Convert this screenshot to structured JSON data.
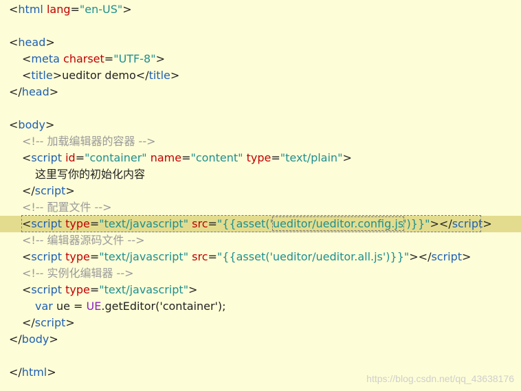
{
  "code": {
    "l1": {
      "lt": "<",
      "tag": "html",
      "attr": "lang",
      "eq": "=",
      "val": "\"en-US\"",
      "gt": ">"
    },
    "l3": {
      "lt": "<",
      "tag": "head",
      "gt": ">"
    },
    "l4": {
      "lt": "<",
      "tag": "meta",
      "attr": "charset",
      "eq": "=",
      "val": "\"UTF-8\"",
      "gt": ">"
    },
    "l5": {
      "lt": "<",
      "tag": "title",
      "gt": ">",
      "text": "ueditor demo",
      "lt2": "</",
      "tag2": "title",
      "gt2": ">"
    },
    "l6": {
      "lt": "</",
      "tag": "head",
      "gt": ">"
    },
    "l8": {
      "lt": "<",
      "tag": "body",
      "gt": ">"
    },
    "l9": {
      "comment": "<!-- 加载编辑器的容器 -->"
    },
    "l10": {
      "lt": "<",
      "tag": "script",
      "a1": "id",
      "eq1": "=",
      "v1": "\"container\"",
      "a2": "name",
      "eq2": "=",
      "v2": "\"content\"",
      "a3": "type",
      "eq3": "=",
      "v3": "\"text/plain\"",
      "gt": ">"
    },
    "l11": {
      "text": "这里写你的初始化内容"
    },
    "l12": {
      "lt": "</",
      "tag": "script",
      "gt": ">"
    },
    "l13": {
      "comment": "<!-- 配置文件 -->"
    },
    "l14": {
      "lt": "<",
      "tag": "script",
      "a1": "type",
      "eq1": "=",
      "v1": "\"text/javascript\"",
      "a2": "src",
      "eq2": "=",
      "v2a": "\"{{asset('",
      "v2b": "ueditor/ueditor.config.js",
      "v2c": "')}}\"",
      "gt": ">",
      "lt2": "</",
      "tag2": "script",
      "gt2": ">"
    },
    "l15": {
      "comment": "<!-- 编辑器源码文件 -->"
    },
    "l16": {
      "lt": "<",
      "tag": "script",
      "a1": "type",
      "eq1": "=",
      "v1": "\"text/javascript\"",
      "a2": "src",
      "eq2": "=",
      "v2": "\"{{asset('ueditor/ueditor.all.js')}}\"",
      "gt": ">",
      "lt2": "</",
      "tag2": "script",
      "gt2": ">"
    },
    "l17": {
      "comment": "<!-- 实例化编辑器 -->"
    },
    "l18": {
      "lt": "<",
      "tag": "script",
      "a1": "type",
      "eq1": "=",
      "v1": "\"text/javascript\"",
      "gt": ">"
    },
    "l19": {
      "kw": "var",
      "id": "ue",
      "eq": "=",
      "obj": "UE",
      "rest": ".getEditor('container');"
    },
    "l20": {
      "lt": "</",
      "tag": "script",
      "gt": ">"
    },
    "l21": {
      "lt": "</",
      "tag": "body",
      "gt": ">"
    },
    "l23": {
      "lt": "</",
      "tag": "html",
      "gt": ">"
    }
  },
  "watermark": "https://blog.csdn.net/qq_43638176"
}
